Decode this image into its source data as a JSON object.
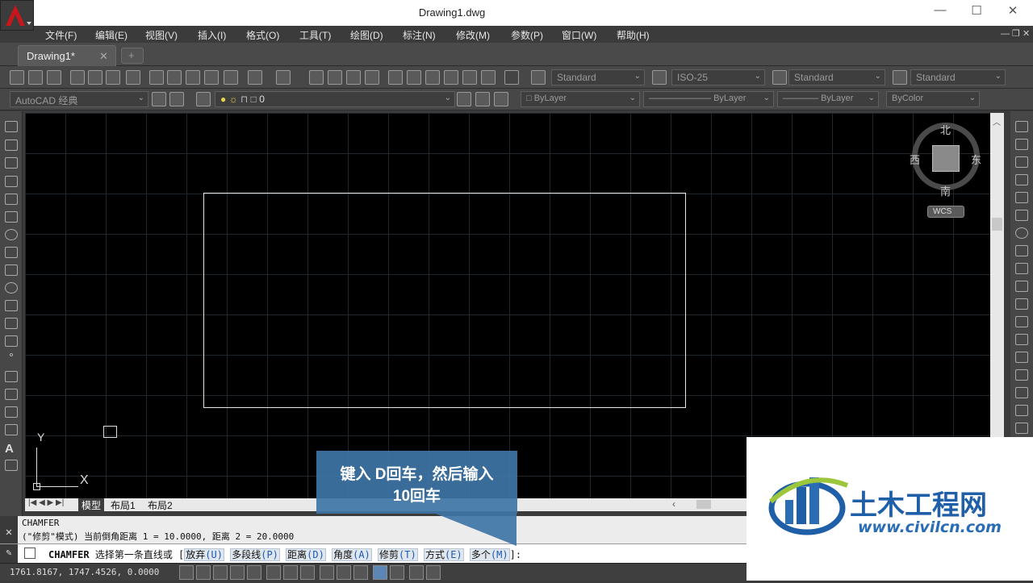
{
  "window": {
    "title": "Drawing1.dwg",
    "minimize": "—",
    "maximize": "☐",
    "close": "✕"
  },
  "menu": [
    "文件(F)",
    "编辑(E)",
    "视图(V)",
    "插入(I)",
    "格式(O)",
    "工具(T)",
    "绘图(D)",
    "标注(N)",
    "修改(M)",
    "参数(P)",
    "窗口(W)",
    "帮助(H)"
  ],
  "tabs": {
    "active": "Drawing1*",
    "close": "✕",
    "new": "+"
  },
  "styles": {
    "text_style": "Standard",
    "dim_style": "ISO-25",
    "table_style": "Standard",
    "mleader_style": "Standard"
  },
  "workspace": "AutoCAD 经典",
  "layer": "0",
  "properties": {
    "color": "ByLayer",
    "linetype": "ByLayer",
    "lineweight": "ByLayer",
    "plotstyle": "ByColor"
  },
  "viewcube": {
    "north": "北",
    "south": "南",
    "west": "西",
    "east": "东",
    "ucs": "WCS"
  },
  "ucs": {
    "y": "Y",
    "x": "X"
  },
  "layout_tabs": [
    "模型",
    "布局1",
    "布局2"
  ],
  "command": {
    "history_1": "CHAMFER",
    "history_2": "(\"修剪\"模式) 当前倒角距离 1 = 10.0000, 距离 2 = 20.0000",
    "prompt_cmd": "CHAMFER",
    "prompt_text": "选择第一条直线或",
    "options": [
      {
        "label": "放弃",
        "key": "(U)"
      },
      {
        "label": "多段线",
        "key": "(P)"
      },
      {
        "label": "距离",
        "key": "(D)"
      },
      {
        "label": "角度",
        "key": "(A)"
      },
      {
        "label": "修剪",
        "key": "(T)"
      },
      {
        "label": "方式",
        "key": "(E)"
      },
      {
        "label": "多个",
        "key": "(M)"
      }
    ],
    "prompt_end": ":"
  },
  "status": {
    "coordinates": "1761.8167, 1747.4526, 0.0000"
  },
  "callout": {
    "line1": "键入 D回车，然后输入",
    "line2": "10回车"
  },
  "colors": {
    "canvas": "#000000",
    "ui_dark": "#3b3b3b",
    "callout": "#3e75a6",
    "accent_red": "#c8161d"
  }
}
